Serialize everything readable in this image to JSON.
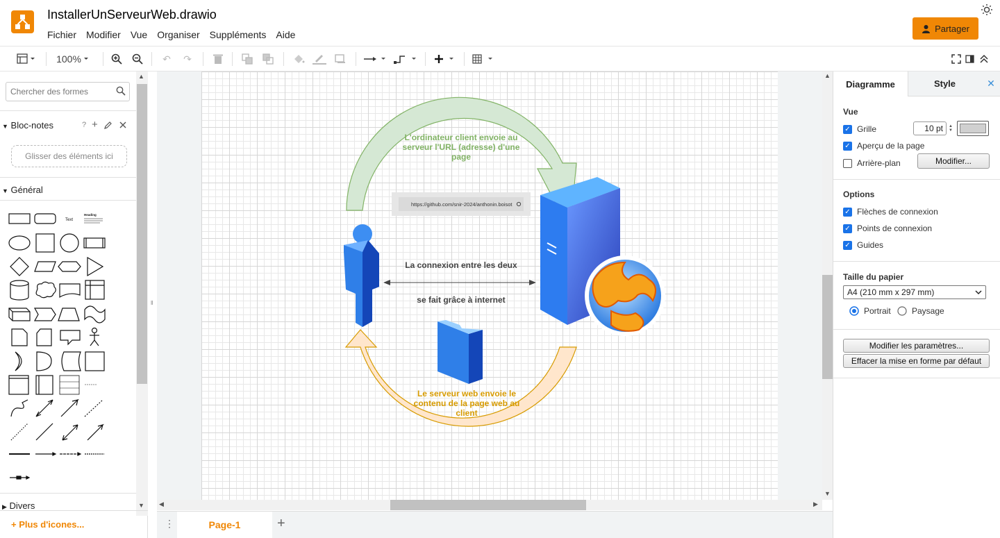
{
  "header": {
    "title": "InstallerUnServeurWeb.drawio",
    "menu": [
      "Fichier",
      "Modifier",
      "Vue",
      "Organiser",
      "Suppléments",
      "Aide"
    ],
    "share_label": "Partager"
  },
  "toolbar": {
    "zoom": "100%"
  },
  "left": {
    "search_placeholder": "Chercher des formes",
    "scratchpad_title": "Bloc-notes",
    "scratchpad_help": "?",
    "scratchpad_drop": "Glisser des éléments ici",
    "general_title": "Général",
    "misc_title": "Divers",
    "more_icons": "+ Plus d'icones...",
    "shape_text": "Text",
    "shape_heading": "Heading"
  },
  "diagram": {
    "top_arrow_label": "L'ordinateur client envoie au serveur l'URL (adresse) d'une page",
    "url": "https://github.com/snir-2024/anthonin.boisot",
    "connection_line1": "La connexion entre les deux",
    "connection_line2": "se fait grâce à internet",
    "bottom_arrow_label": "Le serveur web envoie le contenu de la page web au client"
  },
  "pages": {
    "tab": "Page-1"
  },
  "right": {
    "tab_diagram": "Diagramme",
    "tab_style": "Style",
    "view_title": "Vue",
    "grid_label": "Grille",
    "grid_size": "10 pt",
    "preview_label": "Aperçu de la page",
    "background_label": "Arrière-plan",
    "modify_label": "Modifier...",
    "options_title": "Options",
    "connection_arrows": "Flèches de connexion",
    "connection_points": "Points de connexion",
    "guides": "Guides",
    "paper_title": "Taille du papier",
    "paper_size": "A4 (210 mm x 297 mm)",
    "portrait": "Portrait",
    "landscape": "Paysage",
    "edit_params": "Modifier les paramètres...",
    "clear_format": "Effacer la mise en forme par défaut"
  },
  "colors": {
    "accent": "#f08705",
    "checkbox": "#1a73e8",
    "green_arrow": "#d5e8d4",
    "orange_arrow": "#ffe6cc"
  }
}
